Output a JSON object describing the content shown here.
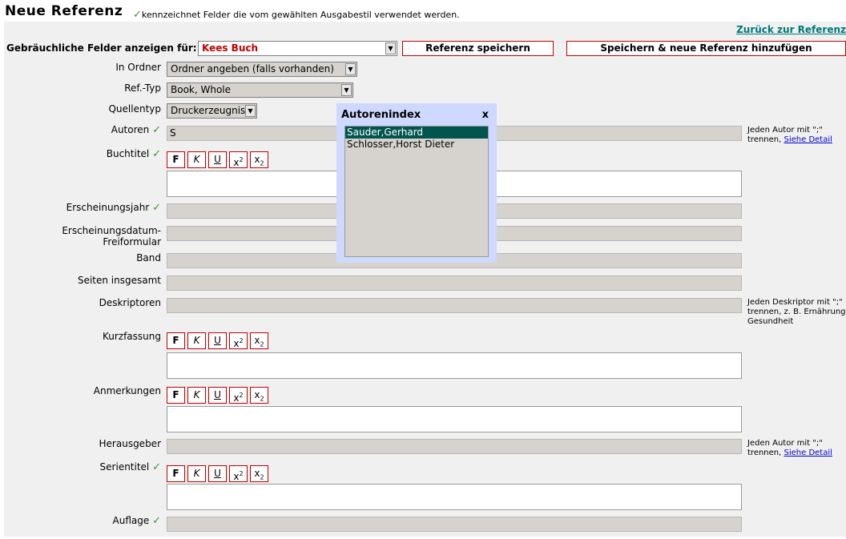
{
  "header": {
    "title": "Neue Referenz",
    "note": "kennzeichnet Felder die vom gewählten Ausgabestil verwendet werden.",
    "back_link": "Zurück zur Referenz"
  },
  "toolbar": {
    "show_fields_label": "Gebräuchliche Felder anzeigen für:",
    "style_value": "Kees Buch",
    "save_label": "Referenz speichern",
    "save_new_label": "Speichern & neue Referenz hinzufügen"
  },
  "form": {
    "folder": {
      "label": "In Ordner",
      "value": "Ordner angeben (falls vorhanden)"
    },
    "reftype": {
      "label": "Ref.-Typ",
      "value": "Book, Whole"
    },
    "sourcetype": {
      "label": "Quellentyp",
      "value": "Druckerzeugnis"
    },
    "authors": {
      "label": "Autoren",
      "value": "S",
      "hint1": "Jeden Autor mit \";\"",
      "hint2": "trennen,",
      "hint_link": "Siehe Detail"
    },
    "booktitle": {
      "label": "Buchtitel"
    },
    "year": {
      "label": "Erscheinungsjahr"
    },
    "pubdate": {
      "label1": "Erscheinungsdatum-",
      "label2": "Freiformular"
    },
    "volume": {
      "label": "Band"
    },
    "pages": {
      "label": "Seiten insgesamt"
    },
    "descriptors": {
      "label": "Deskriptoren",
      "hint1": "Jeden Deskriptor mit \";\"",
      "hint2": "trennen, z. B. Ernährung;",
      "hint3": "Gesundheit"
    },
    "abstract": {
      "label": "Kurzfassung"
    },
    "notes": {
      "label": "Anmerkungen"
    },
    "editors": {
      "label": "Herausgeber",
      "hint1": "Jeden Autor mit \";\"",
      "hint2": "trennen,",
      "hint_link": "Siehe Detail"
    },
    "series": {
      "label": "Serientitel"
    },
    "edition": {
      "label": "Auflage"
    }
  },
  "format_buttons": {
    "bold": "F",
    "italic": "K",
    "underline": "U",
    "sup_base": "x",
    "sup": "2",
    "sub_base": "x",
    "sub": "2"
  },
  "check_mark": "✓",
  "popup": {
    "title": "Autorenindex",
    "close": "x",
    "items": [
      "Sauder,Gerhard",
      "Schlosser,Horst Dieter"
    ]
  }
}
